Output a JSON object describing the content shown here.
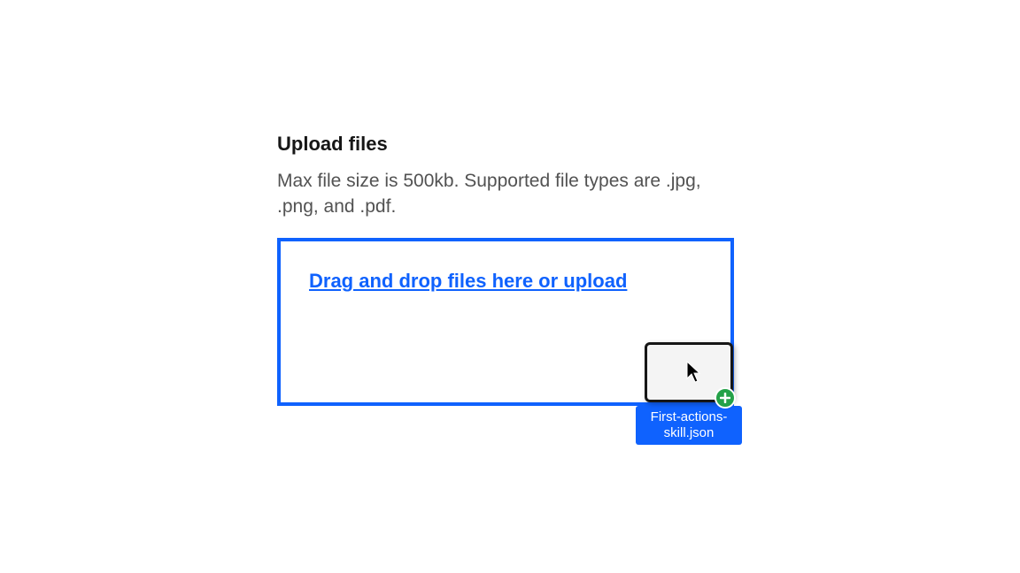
{
  "upload": {
    "title": "Upload files",
    "description": "Max file size is 500kb. Supported file types are .jpg, .png, and .pdf.",
    "dropzone_text": "Drag and drop files here or upload",
    "drag_file": {
      "filename": "First-actions-skill.json"
    }
  },
  "colors": {
    "primary": "#0f62fe",
    "text_primary": "#161616",
    "text_secondary": "#525252",
    "success": "#24a148"
  }
}
